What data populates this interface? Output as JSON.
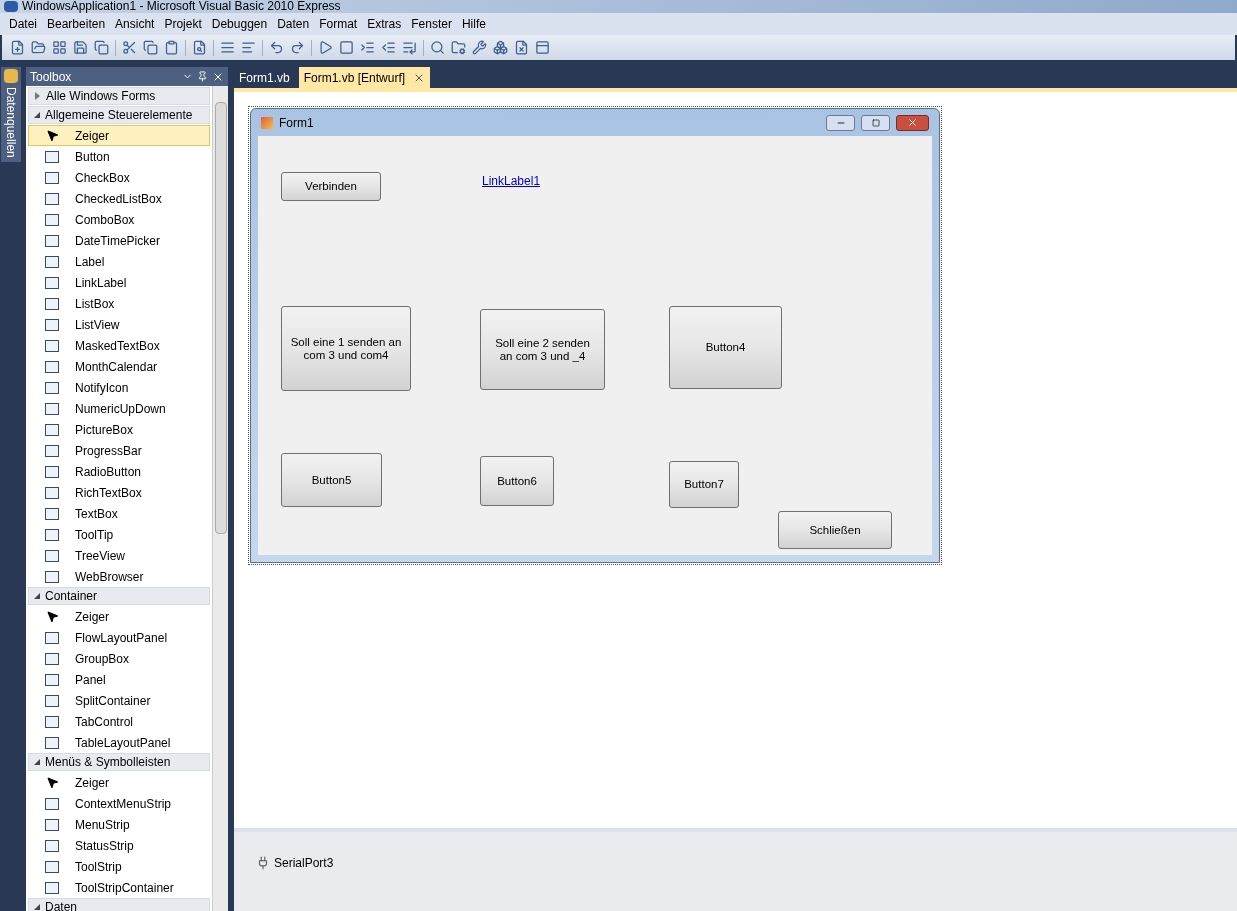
{
  "window": {
    "title": "WindowsApplication1 - Microsoft Visual Basic 2010 Express"
  },
  "menu": [
    "Datei",
    "Bearbeiten",
    "Ansicht",
    "Projekt",
    "Debuggen",
    "Daten",
    "Format",
    "Extras",
    "Fenster",
    "Hilfe"
  ],
  "side_tab": {
    "label": "Datenquellen"
  },
  "toolbox": {
    "title": "Toolbox",
    "sections": [
      {
        "label": "Alle Windows Forms",
        "expanded": false
      },
      {
        "label": "Allgemeine Steuerelemente",
        "expanded": true,
        "items": [
          {
            "label": "Zeiger",
            "selected": true
          },
          {
            "label": "Button",
            "selected": false
          },
          {
            "label": "CheckBox",
            "selected": false
          },
          {
            "label": "CheckedListBox",
            "selected": false
          },
          {
            "label": "ComboBox",
            "selected": false
          },
          {
            "label": "DateTimePicker",
            "selected": false
          },
          {
            "label": "Label",
            "selected": false
          },
          {
            "label": "LinkLabel",
            "selected": false
          },
          {
            "label": "ListBox",
            "selected": false
          },
          {
            "label": "ListView",
            "selected": false
          },
          {
            "label": "MaskedTextBox",
            "selected": false
          },
          {
            "label": "MonthCalendar",
            "selected": false
          },
          {
            "label": "NotifyIcon",
            "selected": false
          },
          {
            "label": "NumericUpDown",
            "selected": false
          },
          {
            "label": "PictureBox",
            "selected": false
          },
          {
            "label": "ProgressBar",
            "selected": false
          },
          {
            "label": "RadioButton",
            "selected": false
          },
          {
            "label": "RichTextBox",
            "selected": false
          },
          {
            "label": "TextBox",
            "selected": false
          },
          {
            "label": "ToolTip",
            "selected": false
          },
          {
            "label": "TreeView",
            "selected": false
          },
          {
            "label": "WebBrowser",
            "selected": false
          }
        ]
      },
      {
        "label": "Container",
        "expanded": true,
        "items": [
          {
            "label": "Zeiger",
            "selected": false
          },
          {
            "label": "FlowLayoutPanel",
            "selected": false
          },
          {
            "label": "GroupBox",
            "selected": false
          },
          {
            "label": "Panel",
            "selected": false
          },
          {
            "label": "SplitContainer",
            "selected": false
          },
          {
            "label": "TabControl",
            "selected": false
          },
          {
            "label": "TableLayoutPanel",
            "selected": false
          }
        ]
      },
      {
        "label": "Menüs & Symbolleisten",
        "expanded": true,
        "items": [
          {
            "label": "Zeiger",
            "selected": false
          },
          {
            "label": "ContextMenuStrip",
            "selected": false
          },
          {
            "label": "MenuStrip",
            "selected": false
          },
          {
            "label": "StatusStrip",
            "selected": false
          },
          {
            "label": "ToolStrip",
            "selected": false
          },
          {
            "label": "ToolStripContainer",
            "selected": false
          }
        ]
      },
      {
        "label": "Daten",
        "expanded": true
      }
    ]
  },
  "tabs": [
    {
      "label": "Form1.vb",
      "selected": false
    },
    {
      "label": "Form1.vb [Entwurf]",
      "selected": true
    }
  ],
  "form": {
    "title": "Form1",
    "controls": [
      {
        "kind": "button",
        "label": "Verbinden"
      },
      {
        "kind": "link",
        "label": "LinkLabel1"
      },
      {
        "kind": "button",
        "label": "Soll eine 1 senden an com 3 und com4"
      },
      {
        "kind": "button",
        "label": "Soll eine 2 senden an com 3 und _4"
      },
      {
        "kind": "button",
        "label": "Button4"
      },
      {
        "kind": "button",
        "label": "Button5"
      },
      {
        "kind": "button",
        "label": "Button6"
      },
      {
        "kind": "button",
        "label": "Button7"
      },
      {
        "kind": "button",
        "label": "Schließen"
      }
    ]
  },
  "component_tray": [
    {
      "label": "SerialPort3"
    }
  ]
}
